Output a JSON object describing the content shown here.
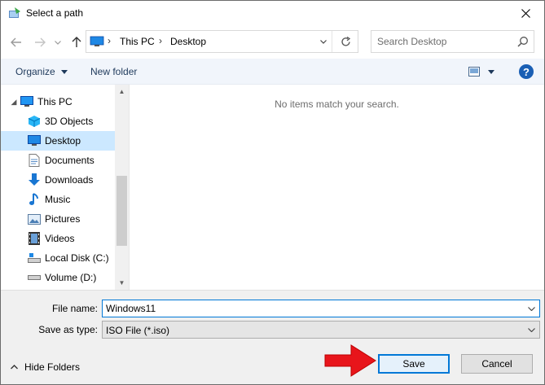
{
  "window": {
    "title": "Select a path",
    "close_icon": "close-icon"
  },
  "nav": {
    "breadcrumb": [
      "This PC",
      "Desktop"
    ],
    "search": {
      "placeholder": "Search Desktop"
    }
  },
  "commands": {
    "organize": "Organize",
    "new_folder": "New folder"
  },
  "tree": [
    {
      "label": "This PC",
      "icon": "computer-icon",
      "level": 0,
      "selected": false
    },
    {
      "label": "3D Objects",
      "icon": "3d-objects-icon",
      "level": 1,
      "selected": false
    },
    {
      "label": "Desktop",
      "icon": "desktop-icon",
      "level": 1,
      "selected": true
    },
    {
      "label": "Documents",
      "icon": "documents-icon",
      "level": 1,
      "selected": false
    },
    {
      "label": "Downloads",
      "icon": "downloads-icon",
      "level": 1,
      "selected": false
    },
    {
      "label": "Music",
      "icon": "music-icon",
      "level": 1,
      "selected": false
    },
    {
      "label": "Pictures",
      "icon": "pictures-icon",
      "level": 1,
      "selected": false
    },
    {
      "label": "Videos",
      "icon": "videos-icon",
      "level": 1,
      "selected": false
    },
    {
      "label": "Local Disk (C:)",
      "icon": "local-disk-icon",
      "level": 1,
      "selected": false
    },
    {
      "label": "Volume (D:)",
      "icon": "volume-drive-icon",
      "level": 1,
      "selected": false
    }
  ],
  "content": {
    "empty_message": "No items match your search."
  },
  "form": {
    "file_name_label": "File name:",
    "file_name_value": "Windows11",
    "save_type_label": "Save as type:",
    "save_type_value": "ISO File (*.iso)"
  },
  "footer": {
    "hide_folders": "Hide Folders",
    "save": "Save",
    "cancel": "Cancel"
  },
  "colors": {
    "accent": "#0078d7",
    "selection": "#cce8ff",
    "annotation_arrow": "#e8151b"
  }
}
